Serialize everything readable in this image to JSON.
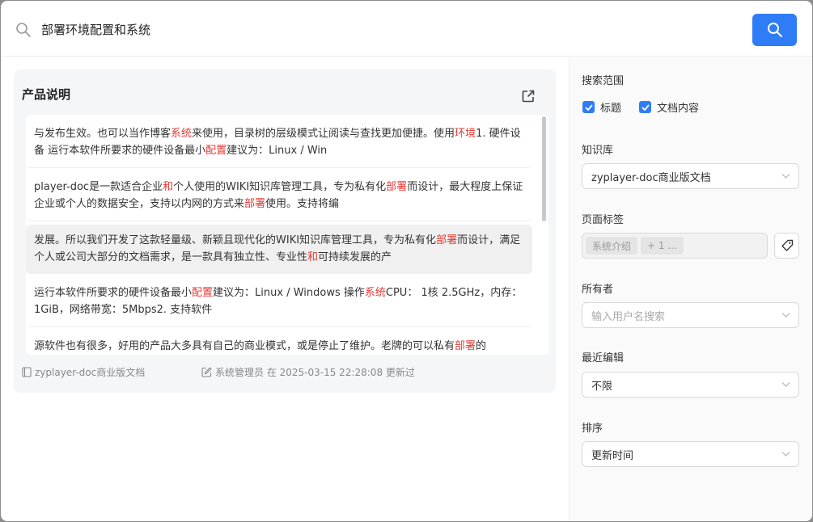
{
  "search": {
    "query": "部署环境配置和系统",
    "button_icon": "search-icon"
  },
  "result": {
    "title": "产品说明",
    "snippets": [
      {
        "parts": [
          {
            "t": "与发布生效。也可以当作博客",
            "h": false
          },
          {
            "t": "系统",
            "h": true
          },
          {
            "t": "来使用，目录树的层级模式让阅读与查找更加便捷。使用",
            "h": false
          },
          {
            "t": "环境",
            "h": true
          },
          {
            "t": "1. 硬件设备 运行本软件所要求的硬件设备最小",
            "h": false
          },
          {
            "t": "配置",
            "h": true
          },
          {
            "t": "建议为：Linux / Win",
            "h": false
          }
        ]
      },
      {
        "parts": [
          {
            "t": "player-doc是一款适合企业",
            "h": false
          },
          {
            "t": "和",
            "h": true
          },
          {
            "t": "个人使用的WIKI知识库管理工具，专为私有化",
            "h": false
          },
          {
            "t": "部署",
            "h": true
          },
          {
            "t": "而设计，最大程度上保证企业或个人的数据安全，支持以内网的方式来",
            "h": false
          },
          {
            "t": "部署",
            "h": true
          },
          {
            "t": "使用。支持将编",
            "h": false
          }
        ]
      },
      {
        "parts": [
          {
            "t": "发展。所以我们开发了这款轻量级、新颖且现代化的WIKI知识库管理工具，专为私有化",
            "h": false
          },
          {
            "t": "部署",
            "h": true
          },
          {
            "t": "而设计，满足个人或公司大部分的文档需求，是一款具有独立性、专业性",
            "h": false
          },
          {
            "t": "和",
            "h": true
          },
          {
            "t": "可持续发展的产",
            "h": false
          }
        ]
      },
      {
        "parts": [
          {
            "t": "运行本软件所要求的硬件设备最小",
            "h": false
          },
          {
            "t": "配置",
            "h": true
          },
          {
            "t": "建议为：Linux / Windows 操作",
            "h": false
          },
          {
            "t": "系统",
            "h": true
          },
          {
            "t": "CPU： 1核 2.5GHz，内存：1GiB，网络带宽：5Mbps2. 支持软件",
            "h": false
          }
        ]
      },
      {
        "parts": [
          {
            "t": "源软件也有很多，好用的产品大多具有自己的商业模式，或是停止了维护。老牌的可以私有",
            "h": false
          },
          {
            "t": "部署",
            "h": true
          },
          {
            "t": "的",
            "h": false
          }
        ]
      }
    ],
    "footer": {
      "kb_name": "zyplayer-doc商业版文档",
      "edit_info": "系统管理员 在 2025-03-15 22:28:08 更新过"
    }
  },
  "filters": {
    "scope_label": "搜索范围",
    "scope_title": "标题",
    "scope_content": "文档内容",
    "kb_label": "知识库",
    "kb_value": "zyplayer-doc商业版文档",
    "tags_label": "页面标签",
    "tag_chip": "系统介绍",
    "tag_more": "+ 1 ...",
    "owner_label": "所有者",
    "owner_placeholder": "输入用户名搜索",
    "recent_label": "最近编辑",
    "recent_value": "不限",
    "sort_label": "排序",
    "sort_value": "更新时间"
  },
  "colors": {
    "accent": "#2e7cf6",
    "highlight": "#e53935"
  }
}
